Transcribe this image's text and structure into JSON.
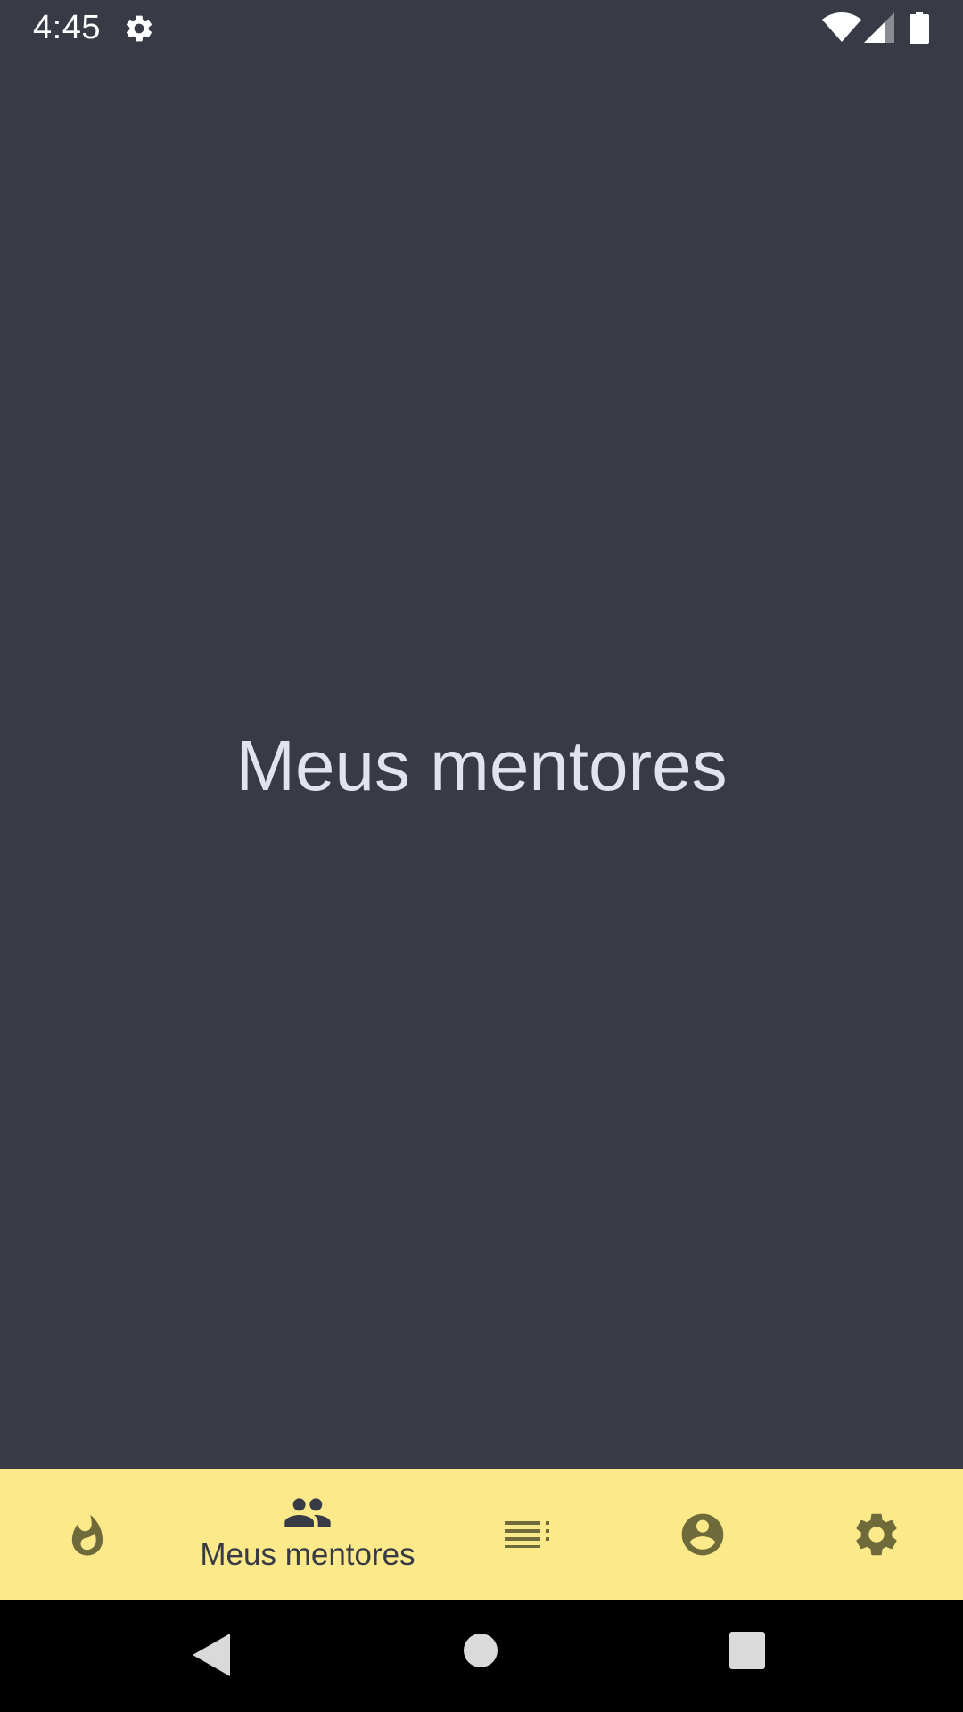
{
  "status_bar": {
    "time": "4:45",
    "icons": [
      "gear-icon",
      "wifi-icon",
      "signal-icon",
      "battery-icon"
    ]
  },
  "main": {
    "title": "Meus mentores"
  },
  "bottom_nav": {
    "items": [
      {
        "icon": "flame-icon",
        "label": "",
        "selected": false
      },
      {
        "icon": "people-icon",
        "label": "Meus mentores",
        "selected": true
      },
      {
        "icon": "list-icon",
        "label": "",
        "selected": false
      },
      {
        "icon": "account-circle-icon",
        "label": "",
        "selected": false
      },
      {
        "icon": "gear-icon",
        "label": "",
        "selected": false
      }
    ]
  },
  "system_nav": {
    "buttons": [
      "back-icon",
      "home-icon",
      "recents-icon"
    ]
  },
  "colors": {
    "background": "#383b46",
    "nav_background": "#fcea8a",
    "nav_icon_inactive": "#6e6a3a",
    "nav_icon_active": "#383b46",
    "title_text": "#e3e3f0"
  }
}
